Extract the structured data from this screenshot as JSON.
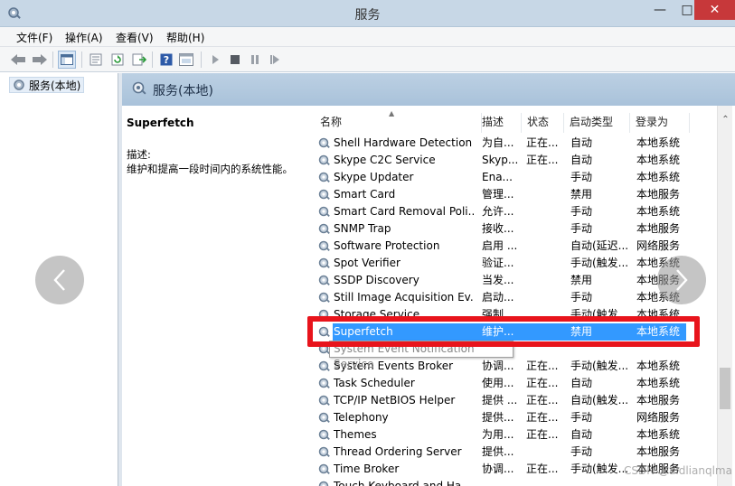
{
  "window": {
    "title": "服务"
  },
  "menubar": {
    "items": [
      "文件(F)",
      "操作(A)",
      "查看(V)",
      "帮助(H)"
    ]
  },
  "tree": {
    "root_label": "服务(本地)"
  },
  "right_pane": {
    "header_title": "服务(本地)"
  },
  "description": {
    "service_name": "Superfetch",
    "label": "描述:",
    "text": "维护和提高一段时间内的系统性能。"
  },
  "list": {
    "columns": [
      "名称",
      "描述",
      "状态",
      "启动类型",
      "登录为"
    ],
    "rows": [
      {
        "name": "Shell Hardware Detection",
        "desc": "为自...",
        "status": "正在...",
        "startup": "自动",
        "logon": "本地系统"
      },
      {
        "name": "Skype C2C Service",
        "desc": "Skyp...",
        "status": "正在...",
        "startup": "自动",
        "logon": "本地系统"
      },
      {
        "name": "Skype Updater",
        "desc": "Ena...",
        "status": "",
        "startup": "手动",
        "logon": "本地系统"
      },
      {
        "name": "Smart Card",
        "desc": "管理...",
        "status": "",
        "startup": "禁用",
        "logon": "本地服务"
      },
      {
        "name": "Smart Card Removal Poli...",
        "desc": "允许...",
        "status": "",
        "startup": "手动",
        "logon": "本地系统"
      },
      {
        "name": "SNMP Trap",
        "desc": "接收...",
        "status": "",
        "startup": "手动",
        "logon": "本地服务"
      },
      {
        "name": "Software Protection",
        "desc": "启用 ...",
        "status": "",
        "startup": "自动(延迟...",
        "logon": "网络服务"
      },
      {
        "name": "Spot Verifier",
        "desc": "验证...",
        "status": "",
        "startup": "手动(触发...",
        "logon": "本地系统"
      },
      {
        "name": "SSDP Discovery",
        "desc": "当发...",
        "status": "",
        "startup": "禁用",
        "logon": "本地服务"
      },
      {
        "name": "Still Image Acquisition Ev...",
        "desc": "启动...",
        "status": "",
        "startup": "手动",
        "logon": "本地系统"
      },
      {
        "name": "Storage Service",
        "desc": "强制...",
        "status": "",
        "startup": "手动(触发...",
        "logon": "本地系统"
      },
      {
        "name": "Superfetch",
        "desc": "维护...",
        "status": "",
        "startup": "禁用",
        "logon": "本地系统",
        "selected": true
      },
      {
        "name": "System Event Notification Service",
        "desc": "",
        "status": "",
        "startup": "",
        "logon": ""
      },
      {
        "name": "System Events Broker",
        "desc": "协调...",
        "status": "正在...",
        "startup": "手动(触发...",
        "logon": "本地系统"
      },
      {
        "name": "Task Scheduler",
        "desc": "使用...",
        "status": "正在...",
        "startup": "自动",
        "logon": "本地系统"
      },
      {
        "name": "TCP/IP NetBIOS Helper",
        "desc": "提供 ...",
        "status": "正在...",
        "startup": "自动(触发...",
        "logon": "本地服务"
      },
      {
        "name": "Telephony",
        "desc": "提供...",
        "status": "正在...",
        "startup": "手动",
        "logon": "网络服务"
      },
      {
        "name": "Themes",
        "desc": "为用...",
        "status": "正在...",
        "startup": "自动",
        "logon": "本地系统"
      },
      {
        "name": "Thread Ordering Server",
        "desc": "提供...",
        "status": "",
        "startup": "手动",
        "logon": "本地服务"
      },
      {
        "name": "Time Broker",
        "desc": "协调...",
        "status": "正在...",
        "startup": "手动(触发...",
        "logon": "本地服务"
      },
      {
        "name": "Touch Keyboard and Ha...",
        "desc": "",
        "status": "",
        "startup": "",
        "logon": ""
      }
    ]
  },
  "tooltip": {
    "text": "System Event Notification Service"
  },
  "watermark": {
    "text": "CSDN @aldlianqlma"
  },
  "colors": {
    "selection": "#3399ff",
    "highlight_border": "#e8141c",
    "titlebar": "#c7d7e6"
  }
}
